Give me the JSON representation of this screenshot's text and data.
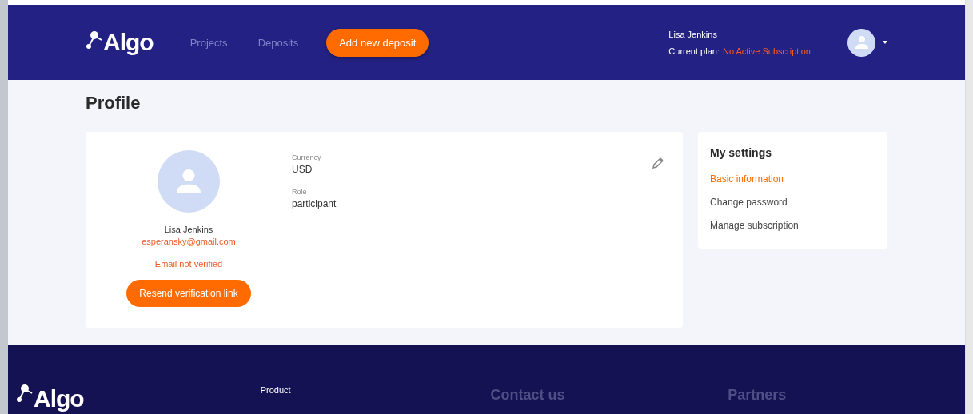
{
  "header": {
    "logo": "Algo",
    "nav": [
      {
        "label": "Projects"
      },
      {
        "label": "Deposits"
      }
    ],
    "add_button": "Add new deposit",
    "user_name": "Lisa Jenkins",
    "plan_label": "Current plan:",
    "plan_value": "No Active Subscription"
  },
  "page_title": "Profile",
  "profile": {
    "name": "Lisa Jenkins",
    "email": "esperansky@gmail.com",
    "verification_status": "Email not verified",
    "resend_button": "Resend verification link",
    "fields": [
      {
        "label": "Currency",
        "value": "USD"
      },
      {
        "label": "Role",
        "value": "participant"
      }
    ]
  },
  "settings": {
    "title": "My settings",
    "items": [
      {
        "label": "Basic information",
        "selected": true
      },
      {
        "label": "Change password",
        "selected": false
      },
      {
        "label": "Manage subscription",
        "selected": false
      }
    ]
  },
  "footer": {
    "logo": "Algo",
    "links": [
      "Product"
    ],
    "headings": [
      "Contact us",
      "Partners"
    ]
  }
}
